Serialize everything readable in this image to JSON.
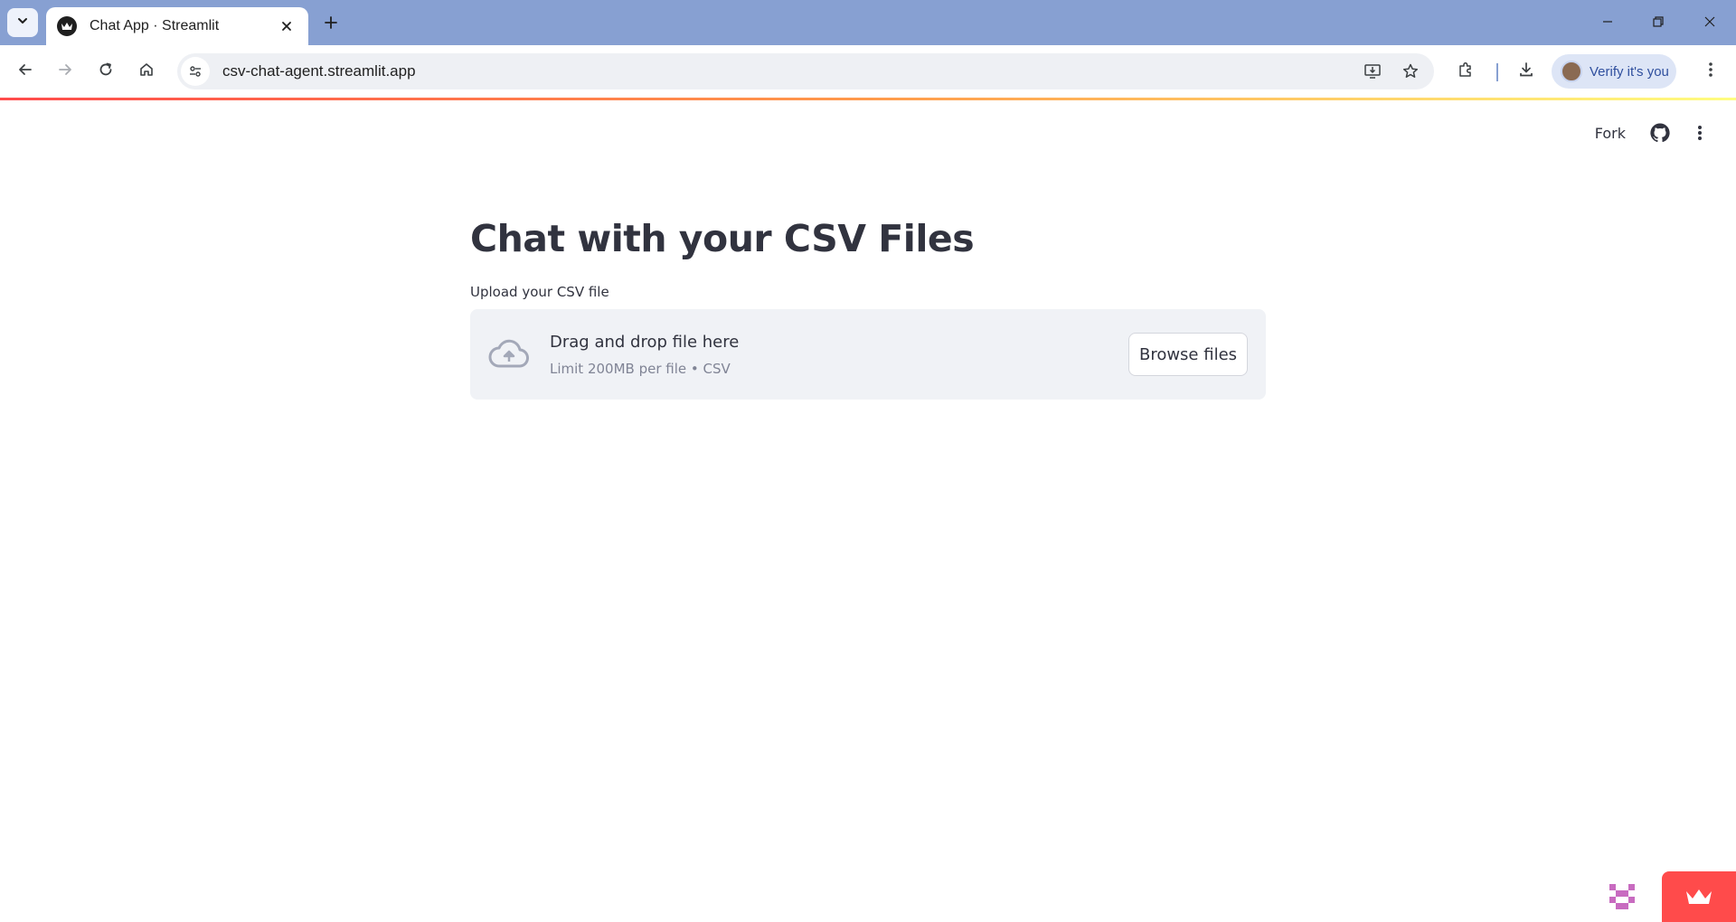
{
  "browser": {
    "tab_title": "Chat App · Streamlit",
    "url": "csv-chat-agent.streamlit.app",
    "profile_label": "Verify it's you",
    "colors": {
      "tabbar": "#87a0d2",
      "omnibox": "#eef0f4",
      "profile_chip": "#dde5f6"
    }
  },
  "app_header": {
    "fork_label": "Fork",
    "icons": [
      "github-icon",
      "more-vertical-icon"
    ]
  },
  "main": {
    "title": "Chat with your CSV Files",
    "uploader": {
      "label": "Upload your CSV file",
      "drop_title": "Drag and drop file here",
      "drop_subtitle": "Limit 200MB per file • CSV",
      "browse_label": "Browse files",
      "icon": "cloud-upload-icon"
    }
  },
  "colors": {
    "text": "#31333f",
    "muted": "#808495",
    "dropzone_bg": "#f0f2f6",
    "accent": "#ff4b4b"
  }
}
